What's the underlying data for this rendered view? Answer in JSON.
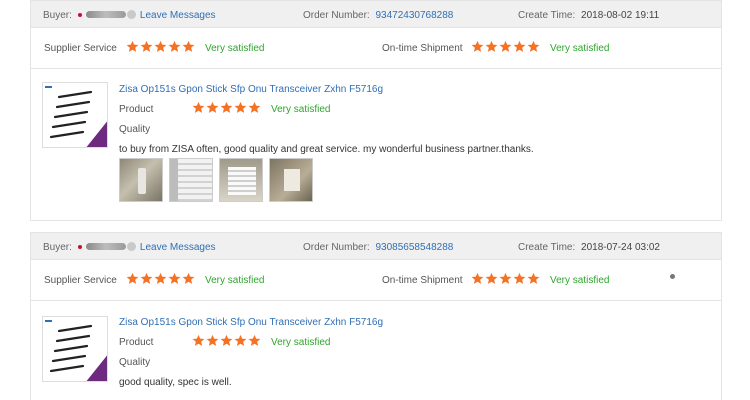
{
  "colors": {
    "star": "#f57224",
    "satisfied": "#2fa52f",
    "link": "#2f6fb6",
    "header_bg": "#f0f0f0"
  },
  "reviews": [
    {
      "buyer_label": "Buyer:",
      "leave_messages": "Leave Messages",
      "order_label": "Order Number:",
      "order_number": "93472430768288",
      "create_label": "Create Time:",
      "create_time": "2018-08-02 19:11",
      "supplier_label": "Supplier Service",
      "supplier_rating": 5,
      "supplier_text": "Very satisfied",
      "shipment_label": "On-time Shipment",
      "shipment_rating": 5,
      "shipment_text": "Very satisfied",
      "product_title": "Zisa Op151s Gpon Stick Sfp Onu Transceiver Zxhn F5716g",
      "product_label": "Product",
      "product_rating": 5,
      "product_text": "Very satisfied",
      "quality_label": "Quality",
      "comment": "to buy from ZISA often, good quality and great service. my wonderful business partner.thanks.",
      "photo_icons": [
        "photo-icon",
        "photo-icon",
        "photo-icon",
        "photo-icon"
      ]
    },
    {
      "buyer_label": "Buyer:",
      "leave_messages": "Leave Messages",
      "order_label": "Order Number:",
      "order_number": "93085658548288",
      "create_label": "Create Time:",
      "create_time": "2018-07-24 03:02",
      "supplier_label": "Supplier Service",
      "supplier_rating": 5,
      "supplier_text": "Very satisfied",
      "shipment_label": "On-time Shipment",
      "shipment_rating": 5,
      "shipment_text": "Very satisfied",
      "product_title": "Zisa Op151s Gpon Stick Sfp Onu Transceiver Zxhn F5716g",
      "product_label": "Product",
      "product_rating": 5,
      "product_text": "Very satisfied",
      "quality_label": "Quality",
      "comment": "good quality, spec is well."
    }
  ]
}
